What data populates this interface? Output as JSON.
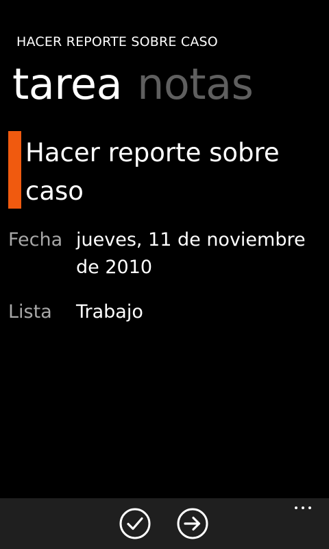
{
  "header": {
    "app_title": "HACER REPORTE SOBRE CASO"
  },
  "pivot": {
    "items": [
      {
        "label": "tarea",
        "active": true
      },
      {
        "label": "notas",
        "active": false
      }
    ]
  },
  "task": {
    "title": "Hacer reporte sobre caso",
    "accent_color": "#f05a0f"
  },
  "details": {
    "date_label": "Fecha",
    "date_value": "jueves, 11 de noviembre de 2010",
    "list_label": "Lista",
    "list_value": "Trabajo"
  },
  "appbar": {
    "buttons": [
      {
        "icon": "check-icon",
        "action": "complete"
      },
      {
        "icon": "arrow-right-icon",
        "action": "next"
      }
    ],
    "more_icon": "ellipsis-icon"
  }
}
